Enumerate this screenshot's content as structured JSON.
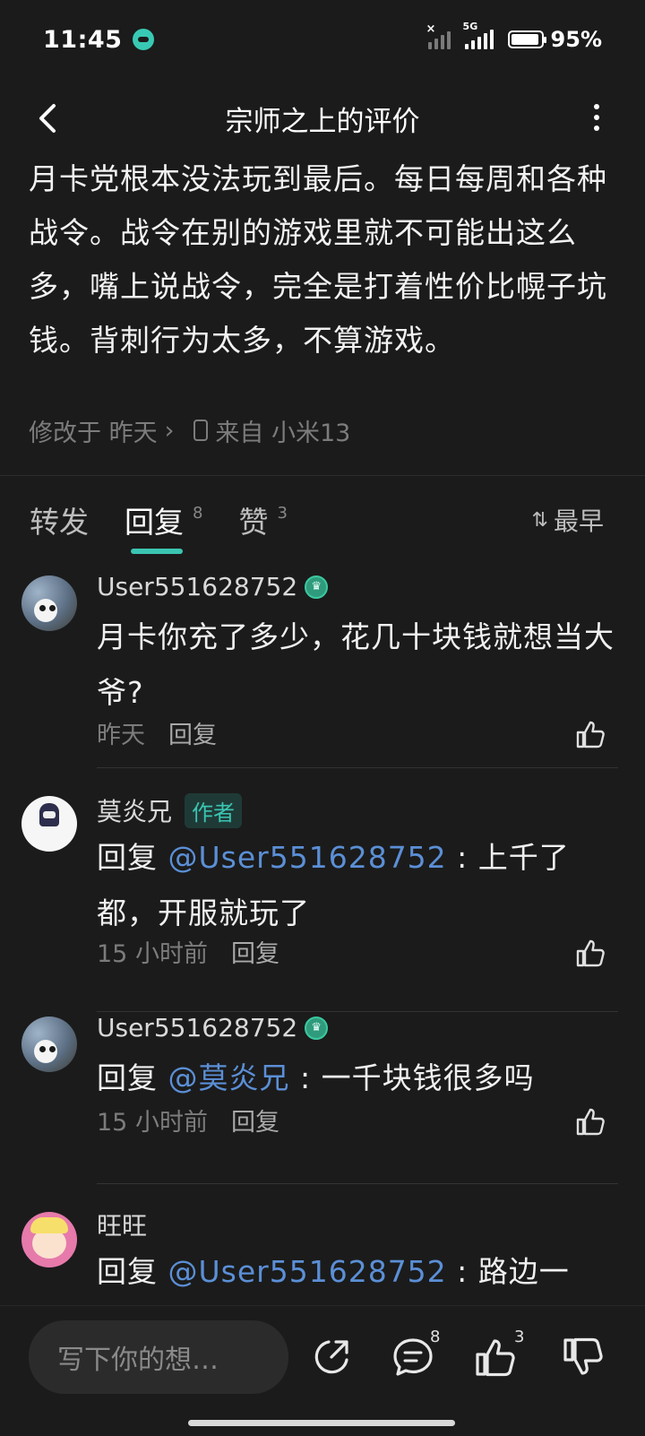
{
  "status_bar": {
    "time": "11:45",
    "network": "5G",
    "battery": "95%",
    "battery_level": 0.95
  },
  "header": {
    "title": "宗师之上的评价"
  },
  "review": {
    "text": "月卡党根本没法玩到最后。每日每周和各种战令。战令在别的游戏里就不可能出这么多，嘴上说战令，完全是打着性价比幌子坑钱。背刺行为太多，不算游戏。",
    "modified_label": "修改于 昨天",
    "device_label": "来自 小米13"
  },
  "tabs": [
    {
      "label": "转发",
      "count": ""
    },
    {
      "label": "回复",
      "count": "8"
    },
    {
      "label": "赞",
      "count": "3"
    }
  ],
  "sort": {
    "label": "最早"
  },
  "replies": [
    {
      "user": "User551628752",
      "badge": true,
      "author_tag": "",
      "prefix": "",
      "mention": "",
      "text": "月卡你充了多少，花几十块钱就想当大爷?",
      "time": "昨天",
      "reply_label": "回复"
    },
    {
      "user": "莫炎兄",
      "badge": false,
      "author_tag": "作者",
      "prefix": "回复 ",
      "mention": "@User551628752",
      "text": " : 上千了都，开服就玩了",
      "time": "15 小时前",
      "reply_label": "回复"
    },
    {
      "user": "User551628752",
      "badge": true,
      "author_tag": "",
      "prefix": "回复 ",
      "mention": "@莫炎兄",
      "text": " : 一千块钱很多吗",
      "time": "15 小时前",
      "reply_label": "回复"
    },
    {
      "user": "旺旺",
      "badge": false,
      "author_tag": "",
      "prefix": "回复 ",
      "mention": "@User551628752",
      "text": " : 路边一",
      "time": "",
      "reply_label": ""
    }
  ],
  "bottom_bar": {
    "input_placeholder": "写下你的想…",
    "comment_count": "8",
    "like_count": "3"
  },
  "colors": {
    "accent": "#3ac5b2",
    "mention": "#5b8fd6",
    "background": "#1b1b1b"
  }
}
